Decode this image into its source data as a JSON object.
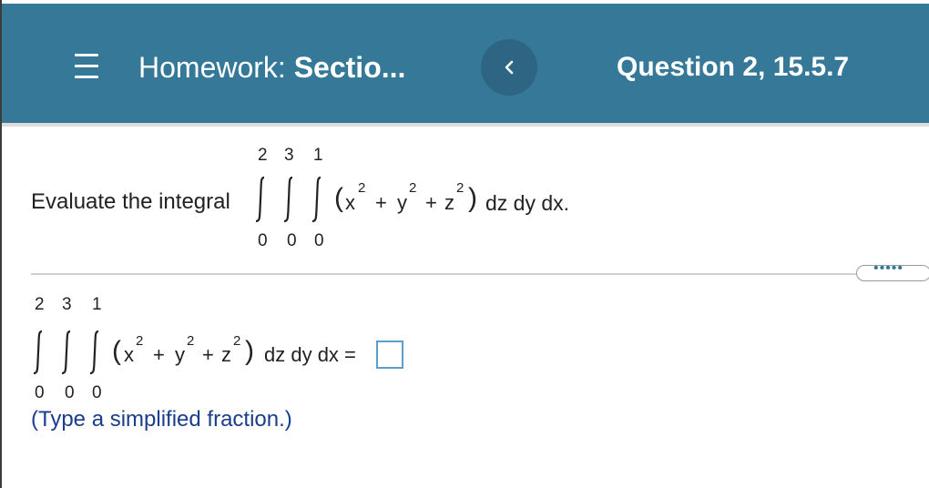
{
  "header": {
    "title_prefix": "Homework: ",
    "title_bold": "Sectio...",
    "question_label": "Question 2, 15.5.7"
  },
  "problem": {
    "prompt": "Evaluate the integral",
    "upper_limits": [
      "2",
      "3",
      "1"
    ],
    "lower_limits": [
      "0",
      "0",
      "0"
    ],
    "x": "x",
    "y": "y",
    "z": "z",
    "exponent": "2",
    "plus": "+",
    "differentials": "dz dy dx."
  },
  "answer": {
    "upper_limits": [
      "2",
      "3",
      "1"
    ],
    "lower_limits": [
      "0",
      "0",
      "0"
    ],
    "differentials": "dz dy dx =",
    "value": "",
    "hint": "(Type a simplified fraction.)"
  },
  "icons": {
    "menu": "hamburger-menu-icon",
    "back": "chevron-left-icon",
    "more": "ellipsis-icon"
  },
  "colors": {
    "header_bg": "#367897",
    "back_btn_bg": "#2d6583",
    "hint_text": "#1a3d8c",
    "answer_box_border": "#5b9ec9"
  }
}
